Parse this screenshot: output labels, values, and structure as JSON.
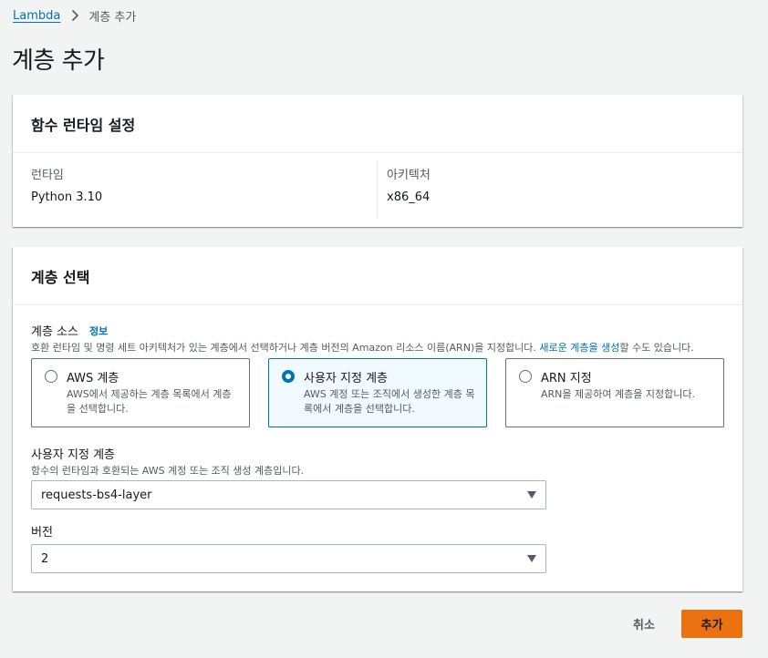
{
  "breadcrumb": {
    "root": "Lambda",
    "current": "계층 추가"
  },
  "page_title": "계층 추가",
  "runtime_panel": {
    "title": "함수 런타임 설정",
    "runtime_label": "런타임",
    "runtime_value": "Python 3.10",
    "arch_label": "아키텍처",
    "arch_value": "x86_64"
  },
  "layer_panel": {
    "title": "계층 선택",
    "source_label": "계층 소스",
    "info_link": "정보",
    "source_desc": "호환 런타임 및 명령 세트 아키텍처가 있는 계층에서 선택하거나 계층 버전의 Amazon 리소스 이름(ARN)을 지정합니다. ",
    "source_desc_link": "새로운 계층을 생성",
    "source_desc_suffix": "할 수도 있습니다.",
    "options": [
      {
        "title": "AWS 계층",
        "desc": "AWS에서 제공하는 계층 목록에서 계층을 선택합니다.",
        "selected": false
      },
      {
        "title": "사용자 지정 계층",
        "desc": "AWS 계정 또는 조직에서 생성한 계층 목록에서 계층을 선택합니다.",
        "selected": true
      },
      {
        "title": "ARN 지정",
        "desc": "ARN을 제공하여 계층을 지정합니다.",
        "selected": false
      }
    ],
    "custom_label": "사용자 지정 계층",
    "custom_desc": "함수의 런타임과 호환되는 AWS 계정 또는 조직 생성 계층입니다.",
    "custom_value": "requests-bs4-layer",
    "version_label": "버전",
    "version_value": "2"
  },
  "footer": {
    "cancel": "취소",
    "add": "추가"
  },
  "colors": {
    "accent": "#0073bb",
    "primary_button": "#ec7211",
    "background": "#f2f3f3"
  }
}
